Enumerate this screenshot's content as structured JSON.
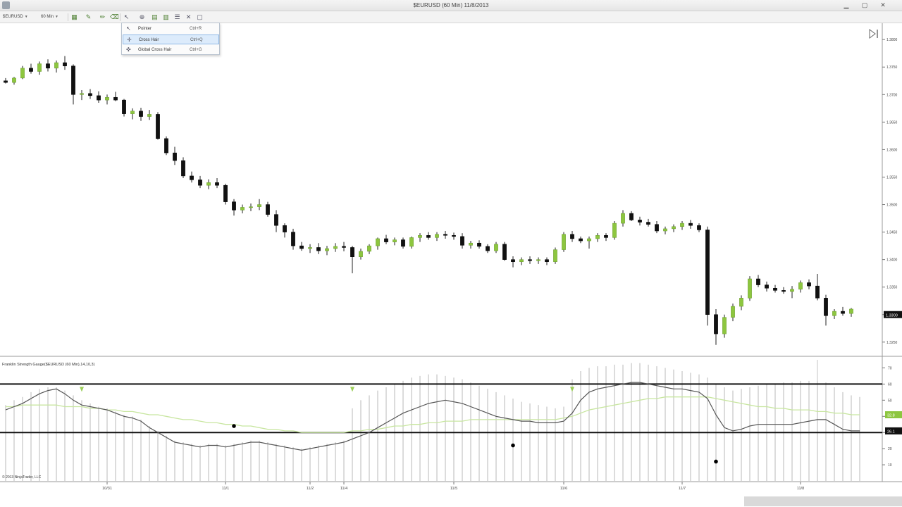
{
  "window": {
    "title": "$EURUSD (60 Min)  11/8/2013"
  },
  "toolbar": {
    "instrument": "$EURUSD",
    "interval": "60 Min"
  },
  "context_menu": {
    "items": [
      {
        "label": "Pointer",
        "shortcut": "Ctrl+R",
        "icon": "pointer-icon",
        "selected": false
      },
      {
        "label": "Cross Hair",
        "shortcut": "Ctrl+Q",
        "icon": "crosshair-icon",
        "selected": true
      },
      {
        "label": "Global Cross Hair",
        "shortcut": "Ctrl+G",
        "icon": "global-crosshair-icon",
        "selected": false
      }
    ]
  },
  "chart_data": {
    "type": "candlestick",
    "price": {
      "ohlc": [
        [
          1.3725,
          1.373,
          1.372,
          1.3722
        ],
        [
          1.3722,
          1.3732,
          1.3718,
          1.373
        ],
        [
          1.373,
          1.3752,
          1.3728,
          1.3748
        ],
        [
          1.3748,
          1.3756,
          1.3738,
          1.3742
        ],
        [
          1.3742,
          1.376,
          1.3736,
          1.3756
        ],
        [
          1.3756,
          1.3764,
          1.3742,
          1.3748
        ],
        [
          1.3748,
          1.3762,
          1.374,
          1.3758
        ],
        [
          1.3758,
          1.377,
          1.3745,
          1.3752
        ],
        [
          1.3752,
          1.3755,
          1.3682,
          1.37
        ],
        [
          1.37,
          1.3708,
          1.369,
          1.3702
        ],
        [
          1.3702,
          1.371,
          1.3692,
          1.3698
        ],
        [
          1.3698,
          1.3706,
          1.3685,
          1.369
        ],
        [
          1.369,
          1.37,
          1.3682,
          1.3695
        ],
        [
          1.3695,
          1.3705,
          1.3688,
          1.369
        ],
        [
          1.369,
          1.3692,
          1.366,
          1.3665
        ],
        [
          1.3665,
          1.3675,
          1.3655,
          1.367
        ],
        [
          1.367,
          1.3676,
          1.3652,
          1.366
        ],
        [
          1.366,
          1.3672,
          1.3654,
          1.3664
        ],
        [
          1.3664,
          1.3668,
          1.3618,
          1.362
        ],
        [
          1.362,
          1.3624,
          1.359,
          1.3594
        ],
        [
          1.3594,
          1.3605,
          1.3572,
          1.358
        ],
        [
          1.358,
          1.3586,
          1.3548,
          1.3552
        ],
        [
          1.3552,
          1.356,
          1.354,
          1.3545
        ],
        [
          1.3545,
          1.3552,
          1.353,
          1.3535
        ],
        [
          1.3535,
          1.3546,
          1.3528,
          1.354
        ],
        [
          1.354,
          1.3548,
          1.353,
          1.3535
        ],
        [
          1.3535,
          1.3538,
          1.35,
          1.3505
        ],
        [
          1.3505,
          1.351,
          1.348,
          1.349
        ],
        [
          1.349,
          1.35,
          1.3484,
          1.3495
        ],
        [
          1.3495,
          1.3502,
          1.3488,
          1.3496
        ],
        [
          1.3496,
          1.351,
          1.349,
          1.35
        ],
        [
          1.35,
          1.3505,
          1.3478,
          1.3482
        ],
        [
          1.3482,
          1.349,
          1.345,
          1.3462
        ],
        [
          1.3462,
          1.3466,
          1.344,
          1.345
        ],
        [
          1.345,
          1.3456,
          1.3418,
          1.3425
        ],
        [
          1.3425,
          1.3432,
          1.3416,
          1.342
        ],
        [
          1.342,
          1.3428,
          1.3412,
          1.3422
        ],
        [
          1.3422,
          1.343,
          1.341,
          1.3416
        ],
        [
          1.3416,
          1.3425,
          1.3408,
          1.342
        ],
        [
          1.342,
          1.343,
          1.3414,
          1.3424
        ],
        [
          1.3424,
          1.3432,
          1.3415,
          1.3422
        ],
        [
          1.3422,
          1.3425,
          1.3375,
          1.3405
        ],
        [
          1.3405,
          1.342,
          1.34,
          1.3415
        ],
        [
          1.3415,
          1.3428,
          1.341,
          1.3425
        ],
        [
          1.3425,
          1.344,
          1.3418,
          1.3438
        ],
        [
          1.3438,
          1.3445,
          1.3428,
          1.3432
        ],
        [
          1.3432,
          1.344,
          1.3426,
          1.3436
        ],
        [
          1.3436,
          1.344,
          1.342,
          1.3424
        ],
        [
          1.3424,
          1.3442,
          1.342,
          1.344
        ],
        [
          1.344,
          1.3448,
          1.3432,
          1.3444
        ],
        [
          1.3444,
          1.345,
          1.3436,
          1.344
        ],
        [
          1.344,
          1.345,
          1.3434,
          1.3446
        ],
        [
          1.3446,
          1.3452,
          1.3438,
          1.3444
        ],
        [
          1.3444,
          1.3449,
          1.3436,
          1.3442
        ],
        [
          1.3442,
          1.3448,
          1.342,
          1.3426
        ],
        [
          1.3426,
          1.3434,
          1.342,
          1.343
        ],
        [
          1.343,
          1.3435,
          1.342,
          1.3424
        ],
        [
          1.3424,
          1.3428,
          1.3412,
          1.3416
        ],
        [
          1.3416,
          1.3432,
          1.3412,
          1.3428
        ],
        [
          1.3428,
          1.3432,
          1.3398,
          1.34
        ],
        [
          1.34,
          1.3406,
          1.3386,
          1.3396
        ],
        [
          1.3396,
          1.3404,
          1.339,
          1.34
        ],
        [
          1.34,
          1.3406,
          1.3392,
          1.3398
        ],
        [
          1.3398,
          1.3404,
          1.3392,
          1.34
        ],
        [
          1.34,
          1.3404,
          1.339,
          1.3396
        ],
        [
          1.3396,
          1.3422,
          1.3392,
          1.3418
        ],
        [
          1.3418,
          1.345,
          1.3414,
          1.3446
        ],
        [
          1.3446,
          1.3452,
          1.3432,
          1.3438
        ],
        [
          1.3438,
          1.3442,
          1.343,
          1.3434
        ],
        [
          1.3434,
          1.3442,
          1.342,
          1.3438
        ],
        [
          1.3438,
          1.3448,
          1.3432,
          1.3444
        ],
        [
          1.3444,
          1.3448,
          1.3434,
          1.344
        ],
        [
          1.344,
          1.347,
          1.3436,
          1.3466
        ],
        [
          1.3466,
          1.349,
          1.346,
          1.3484
        ],
        [
          1.3484,
          1.3488,
          1.347,
          1.3472
        ],
        [
          1.3472,
          1.3478,
          1.3462,
          1.3468
        ],
        [
          1.3468,
          1.3474,
          1.346,
          1.3464
        ],
        [
          1.3464,
          1.347,
          1.3448,
          1.3452
        ],
        [
          1.3452,
          1.346,
          1.3446,
          1.3456
        ],
        [
          1.3456,
          1.3464,
          1.345,
          1.346
        ],
        [
          1.346,
          1.347,
          1.3454,
          1.3466
        ],
        [
          1.3466,
          1.3472,
          1.3456,
          1.3462
        ],
        [
          1.3462,
          1.3466,
          1.345,
          1.3454
        ],
        [
          1.3454,
          1.346,
          1.328,
          1.33
        ],
        [
          1.33,
          1.331,
          1.3245,
          1.3265
        ],
        [
          1.3265,
          1.33,
          1.3258,
          1.3295
        ],
        [
          1.3295,
          1.332,
          1.3288,
          1.3315
        ],
        [
          1.3315,
          1.3335,
          1.3308,
          1.333
        ],
        [
          1.333,
          1.337,
          1.3325,
          1.3365
        ],
        [
          1.3365,
          1.3372,
          1.335,
          1.3354
        ],
        [
          1.3354,
          1.336,
          1.3342,
          1.3348
        ],
        [
          1.3348,
          1.3354,
          1.334,
          1.3344
        ],
        [
          1.3344,
          1.335,
          1.3338,
          1.3342
        ],
        [
          1.3342,
          1.3352,
          1.333,
          1.3346
        ],
        [
          1.3346,
          1.3362,
          1.334,
          1.3358
        ],
        [
          1.3358,
          1.3364,
          1.3346,
          1.3352
        ],
        [
          1.3352,
          1.3374,
          1.3326,
          1.333
        ],
        [
          1.333,
          1.3336,
          1.328,
          1.3298
        ],
        [
          1.3298,
          1.331,
          1.3292,
          1.3306
        ],
        [
          1.3306,
          1.3314,
          1.3298,
          1.3302
        ],
        [
          1.3302,
          1.3312,
          1.3296,
          1.331
        ]
      ],
      "y_ticks": [
        "1.3800",
        "1.3750",
        "1.3700",
        "1.3650",
        "1.3600",
        "1.3550",
        "1.3500",
        "1.3450",
        "1.3400",
        "1.3350",
        "1.3300",
        "1.3250"
      ],
      "ylim": [
        1.3228,
        1.3822
      ],
      "last_price_label": "1.3300"
    },
    "indicator": {
      "title": "Franklin Strength Gauge($EURUSD (60 Min),14,10,3)",
      "y_ticks": [
        "70",
        "60",
        "50",
        "40",
        "30",
        "20",
        "10"
      ],
      "ylim": [
        0,
        75
      ],
      "levels": [
        60,
        30
      ],
      "oscillator": [
        44,
        46,
        48,
        51,
        54,
        56,
        57,
        54,
        50,
        47,
        46,
        45,
        44,
        42,
        40,
        39,
        37,
        33,
        30,
        27,
        24,
        23,
        22,
        21,
        22,
        22,
        21,
        22,
        23,
        24,
        24,
        23,
        22,
        21,
        20,
        19,
        20,
        21,
        22,
        23,
        24,
        26,
        28,
        30,
        33,
        36,
        39,
        42,
        44,
        46,
        48,
        49,
        50,
        49,
        48,
        46,
        44,
        42,
        40,
        39,
        38,
        37,
        37,
        36,
        36,
        36,
        37,
        42,
        50,
        55,
        57,
        58,
        59,
        60,
        61,
        61,
        60,
        59,
        58,
        57,
        57,
        56,
        55,
        51,
        41,
        33,
        31,
        32,
        34,
        35,
        35,
        35,
        35,
        35,
        36,
        37,
        38,
        38,
        35,
        32,
        31,
        31
      ],
      "signal": [
        46,
        46,
        47,
        47,
        47,
        47,
        47,
        46,
        46,
        46,
        45,
        45,
        44,
        44,
        43,
        43,
        42,
        41,
        41,
        40,
        39,
        38,
        38,
        37,
        36,
        36,
        35,
        35,
        34,
        34,
        33,
        32,
        32,
        31,
        31,
        30,
        30,
        30,
        30,
        30,
        30,
        31,
        31,
        32,
        32,
        33,
        34,
        34,
        35,
        35,
        36,
        36,
        37,
        37,
        37,
        38,
        38,
        38,
        38,
        38,
        38,
        38,
        38,
        38,
        38,
        38,
        39,
        40,
        42,
        44,
        45,
        46,
        47,
        48,
        49,
        50,
        51,
        51,
        52,
        52,
        52,
        52,
        52,
        52,
        51,
        50,
        49,
        48,
        47,
        46,
        46,
        45,
        45,
        44,
        44,
        44,
        43,
        43,
        42,
        42,
        41,
        41
      ],
      "histogram": [
        47,
        50,
        52,
        55,
        57,
        58,
        58,
        56,
        53,
        50,
        48,
        46,
        45,
        43,
        41,
        40,
        38,
        34,
        31,
        28,
        25,
        24,
        23,
        22,
        23,
        23,
        22,
        23,
        24,
        25,
        25,
        24,
        23,
        22,
        21,
        20,
        21,
        22,
        23,
        24,
        25,
        45,
        50,
        53,
        56,
        58,
        60,
        62,
        64,
        65,
        66,
        66,
        65,
        64,
        63,
        61,
        59,
        57,
        55,
        53,
        51,
        49,
        48,
        47,
        46,
        45,
        46,
        63,
        68,
        70,
        71,
        71,
        72,
        72,
        73,
        73,
        72,
        71,
        70,
        69,
        68,
        67,
        66,
        64,
        60,
        58,
        56,
        57,
        58,
        59,
        60,
        60,
        61,
        61,
        62,
        62,
        62,
        61,
        58,
        55,
        53,
        52
      ],
      "histogram_tall": [
        96,
        112,
        120,
        124
      ],
      "arrows": [
        9,
        41,
        67
      ],
      "dots": [
        [
          27,
          34
        ],
        [
          60,
          22
        ],
        [
          84,
          12
        ]
      ],
      "value_labels": [
        "32.8",
        "26.1"
      ]
    },
    "x_tick_labels": [
      "10/31",
      "11/1",
      "11/2",
      "11/4",
      "11/5",
      "11/6",
      "11/7",
      "11/8"
    ],
    "x_tick_index": [
      12,
      26,
      36,
      40,
      53,
      66,
      80,
      94
    ],
    "copyright": "© 2013 NinjaTrader, LLC"
  },
  "colors": {
    "up_candle": "#8dc63f",
    "down_candle": "#111111",
    "oscillator": "#555555",
    "signal": "#c8e6a0",
    "histogram": "#c4c4c4",
    "level_line": "#111111",
    "selection": "#dcebfb"
  }
}
